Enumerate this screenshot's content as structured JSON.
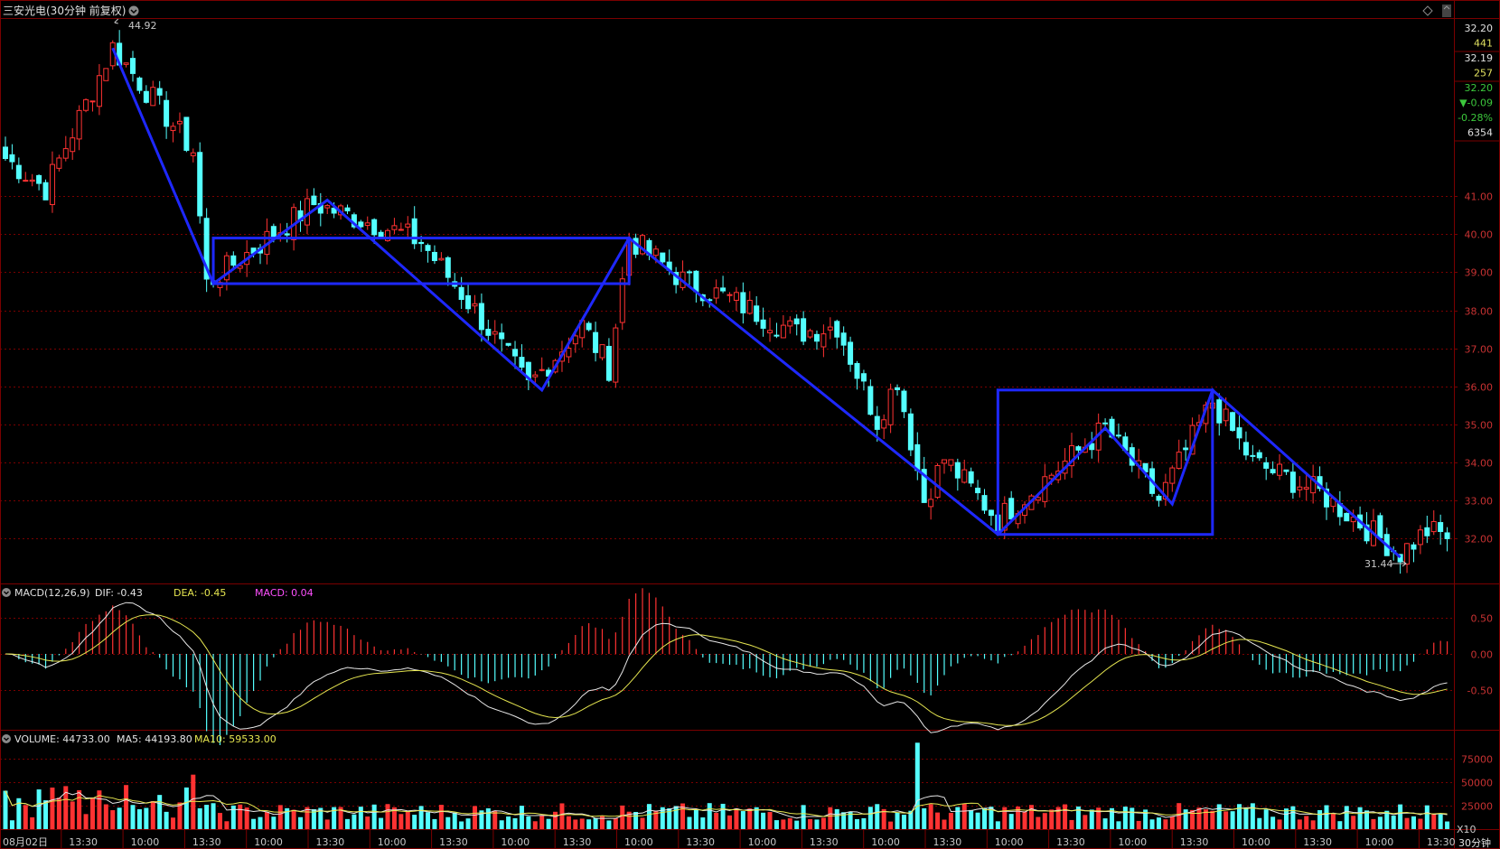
{
  "header": {
    "stock_title": "三安光电(30分钟 前复权)",
    "toggle_icon": "chevron-circle-icon",
    "diamond_icon": "diamond-icon",
    "scrollbar_label": ""
  },
  "side_panel": {
    "lines": [
      {
        "text": "32.20",
        "color": "#e0e0e0"
      },
      {
        "text": "441",
        "color": "#e0e060"
      },
      {
        "text": "32.19",
        "color": "#e0e0e0"
      },
      {
        "text": "257",
        "color": "#e0e060"
      },
      {
        "text": "32.20",
        "color": "#3cc83c"
      },
      {
        "text": "▼-0.09",
        "color": "#3cc83c"
      },
      {
        "text": "-0.28%",
        "color": "#3cc83c"
      },
      {
        "text": "6354",
        "color": "#e0e0e0"
      }
    ]
  },
  "chart_data": {
    "type": "candlestick",
    "colors": {
      "up": "#ff3232",
      "down": "#54ffff",
      "pattern": "#1e28ff",
      "grid": "#7a0000",
      "dif": "#e6e6e6",
      "dea": "#e6e650",
      "macd_label": "#ff50ff"
    },
    "price_axis": {
      "ticks": [
        "41.00",
        "40.00",
        "39.00",
        "38.00",
        "37.00",
        "36.00",
        "35.00",
        "34.00",
        "33.00",
        "32.00"
      ],
      "range": [
        31.0,
        45.5
      ]
    },
    "markers": {
      "high": "44.92",
      "low": "31.44"
    },
    "time_axis": [
      "08月02日",
      "13:30",
      "10:00",
      "13:30",
      "10:00",
      "13:30",
      "10:00",
      "13:30",
      "10:00",
      "13:30",
      "10:00",
      "13:30",
      "10:00",
      "13:30",
      "10:00",
      "13:30",
      "10:00",
      "13:30",
      "10:00",
      "13:30",
      "10:00",
      "13:30",
      "10:00",
      "13:30"
    ],
    "period_label": "30分钟",
    "anchors": [
      {
        "i": 0,
        "p": 42.0
      },
      {
        "i": 6,
        "p": 41.2
      },
      {
        "i": 16,
        "p": 44.92
      },
      {
        "i": 28,
        "p": 42.2
      },
      {
        "i": 30,
        "p": 38.7
      },
      {
        "i": 46,
        "p": 40.8
      },
      {
        "i": 58,
        "p": 40.1
      },
      {
        "i": 62,
        "p": 39.8
      },
      {
        "i": 70,
        "p": 38.0
      },
      {
        "i": 78,
        "p": 36.0
      },
      {
        "i": 86,
        "p": 37.6
      },
      {
        "i": 90,
        "p": 36.5
      },
      {
        "i": 93,
        "p": 39.9
      },
      {
        "i": 101,
        "p": 38.8
      },
      {
        "i": 108,
        "p": 38.3
      },
      {
        "i": 118,
        "p": 37.4
      },
      {
        "i": 124,
        "p": 37.6
      },
      {
        "i": 130,
        "p": 35.1
      },
      {
        "i": 133,
        "p": 36.2
      },
      {
        "i": 137,
        "p": 33.0
      },
      {
        "i": 140,
        "p": 34.1
      },
      {
        "i": 148,
        "p": 32.5
      },
      {
        "i": 164,
        "p": 34.9
      },
      {
        "i": 172,
        "p": 33.0
      },
      {
        "i": 180,
        "p": 35.6
      },
      {
        "i": 186,
        "p": 34.0
      },
      {
        "i": 196,
        "p": 33.2
      },
      {
        "i": 208,
        "p": 31.6
      },
      {
        "i": 212,
        "p": 32.2
      }
    ],
    "pattern_lines": [
      {
        "type": "polyline",
        "points": [
          [
            16,
            44.9
          ],
          [
            31,
            38.7
          ],
          [
            48,
            40.9
          ],
          [
            80,
            35.9
          ],
          [
            93,
            39.9
          ],
          [
            148,
            32.1
          ],
          [
            164,
            34.9
          ],
          [
            174,
            32.9
          ],
          [
            180,
            35.9
          ],
          [
            208,
            31.5
          ]
        ]
      },
      {
        "type": "rect",
        "i0": 31,
        "i1": 93,
        "p0": 38.7,
        "p1": 39.9
      },
      {
        "type": "rect",
        "i0": 148,
        "i1": 180,
        "p0": 32.1,
        "p1": 35.9
      }
    ],
    "macd": {
      "title": "MACD(12,26,9)",
      "dif": "DIF: -0.43",
      "dea": "DEA: -0.45",
      "macd": "MACD: 0.04",
      "ticks": [
        "0.50",
        "0.00",
        "-0.50"
      ],
      "range": [
        -1.0,
        0.85
      ]
    },
    "volume": {
      "title": "VOLUME: 44733.00",
      "ma5": "MA5: 44193.80",
      "ma10": "MA10: 59533.00",
      "ticks": [
        "75000",
        "50000",
        "25000"
      ],
      "unit": "X10",
      "max": 100000
    }
  }
}
